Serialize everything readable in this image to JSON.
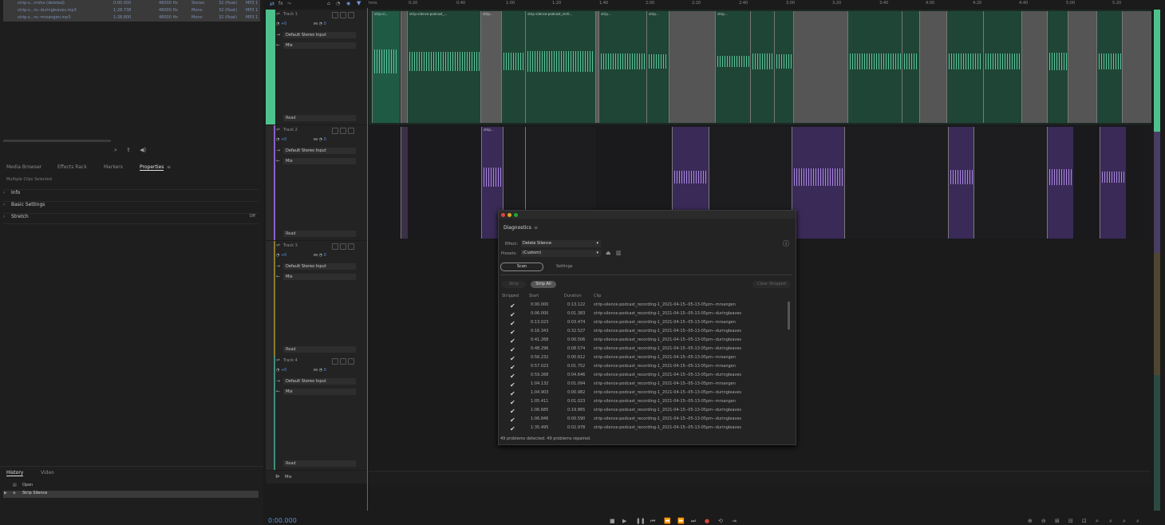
{
  "files": [
    {
      "name": "strip-s...nrdns (deleted)",
      "duration": "0:00.000",
      "rate": "48000 Hz",
      "channels": "Stereo",
      "bit": "32 (float)",
      "format": "MP3 1"
    },
    {
      "name": "strip-s...rs--duringleaves.mp3",
      "duration": "1:28.738",
      "rate": "48000 Hz",
      "channels": "Mono",
      "bit": "32 (float)",
      "format": "MP3 1"
    },
    {
      "name": "strip-s...rs--mrsangen.mp3",
      "duration": "1:28.800",
      "rate": "48000 Hz",
      "channels": "Mono",
      "bit": "32 (float)",
      "format": "MP3 1"
    }
  ],
  "panel_tabs": [
    "Media Browser",
    "Effects Rack",
    "Markers",
    "Properties"
  ],
  "panel_selection": "Multiple Clips Selected",
  "properties": [
    {
      "label": "Info",
      "value": ""
    },
    {
      "label": "Basic Settings",
      "value": ""
    },
    {
      "label": "Stretch",
      "value": "Off"
    }
  ],
  "history": {
    "tabs": [
      "History",
      "Video"
    ],
    "items": [
      "Open",
      "Strip Silence"
    ]
  },
  "timecode": "0:00.000",
  "ruler": [
    "hms",
    "0:20",
    "0:40",
    "1:00",
    "1:20",
    "1:40",
    "2:00",
    "2:20",
    "2:40",
    "3:00",
    "3:20",
    "3:40",
    "4:00",
    "4:20",
    "4:40",
    "5:00",
    "5:20"
  ],
  "tracks": [
    {
      "name": "Track 1",
      "vol": "+0",
      "pan": "0",
      "input": "Default Stereo Input",
      "mix": "Mix",
      "mode": "Read",
      "color": "#4ec28d"
    },
    {
      "name": "Track 2",
      "vol": "+0",
      "pan": "0",
      "input": "Default Stereo Input",
      "mix": "Mix",
      "mode": "Read",
      "color": "#8a5fc9"
    },
    {
      "name": "Track 3",
      "vol": "+0",
      "pan": "0",
      "input": "Default Stereo Input",
      "mix": "Mix",
      "mode": "Read",
      "color": "#8c7a2c"
    },
    {
      "name": "Track 4",
      "vol": "+0",
      "pan": "0",
      "input": "Default Stereo Input",
      "mix": "Mix",
      "mode": "Read",
      "color": "#3e8f7a"
    }
  ],
  "master": {
    "name": "Mix"
  },
  "clip_labels": {
    "t1": [
      "strip-si...",
      "strip-silence-podcast_...",
      "strip...",
      "strip-silence-podcast_recti...",
      "strip...",
      "strip...",
      "strip..."
    ],
    "t2": [
      "strip..."
    ]
  },
  "diagnostics": {
    "title": "Diagnostics",
    "effect_label": "Effect:",
    "effect_value": "Delete Silence",
    "presets_label": "Presets:",
    "presets_value": "(Custom)",
    "tabs": [
      "Scan",
      "Settings"
    ],
    "actions": [
      "Strip",
      "Strip All",
      "Clear Stripped"
    ],
    "columns": [
      "Stripped",
      "Start",
      "Duration",
      "Clip"
    ],
    "rows": [
      {
        "start": "0:00.000",
        "duration": "0:13.122",
        "clip": "strip-silence-podcast_recording-1_2021-04-15--05-13-05pm--mrsangen"
      },
      {
        "start": "0:06.000",
        "duration": "0:01.383",
        "clip": "strip-silence-podcast_recording-1_2021-04-15--05-13-05pm--duringleaves"
      },
      {
        "start": "0:13.023",
        "duration": "0:03.474",
        "clip": "strip-silence-podcast_recording-1_2021-04-15--05-13-05pm--mrsangen"
      },
      {
        "start": "0:16.343",
        "duration": "0:32.527",
        "clip": "strip-silence-podcast_recording-1_2021-04-15--05-13-05pm--duringleaves"
      },
      {
        "start": "0:41.268",
        "duration": "0:00.506",
        "clip": "strip-silence-podcast_recording-1_2021-04-15--05-13-05pm--duringleaves"
      },
      {
        "start": "0:48.296",
        "duration": "0:08.574",
        "clip": "strip-silence-podcast_recording-1_2021-04-15--05-13-05pm--duringleaves"
      },
      {
        "start": "0:56.232",
        "duration": "0:00.612",
        "clip": "strip-silence-podcast_recording-1_2021-04-15--05-13-05pm--mrsangen"
      },
      {
        "start": "0:57.023",
        "duration": "0:01.752",
        "clip": "strip-silence-podcast_recording-1_2021-04-15--05-13-05pm--mrsangen"
      },
      {
        "start": "0:59.268",
        "duration": "0:04.646",
        "clip": "strip-silence-podcast_recording-1_2021-04-15--05-13-05pm--duringleaves"
      },
      {
        "start": "1:04.132",
        "duration": "0:01.094",
        "clip": "strip-silence-podcast_recording-1_2021-04-15--05-13-05pm--mrsangen"
      },
      {
        "start": "1:04.903",
        "duration": "0:00.982",
        "clip": "strip-silence-podcast_recording-1_2021-04-15--05-13-05pm--duringleaves"
      },
      {
        "start": "1:05.411",
        "duration": "0:01.023",
        "clip": "strip-silence-podcast_recording-1_2021-04-15--05-13-05pm--mrsangen"
      },
      {
        "start": "1:06.685",
        "duration": "0:19.865",
        "clip": "strip-silence-podcast_recording-1_2021-04-15--05-13-05pm--duringleaves"
      },
      {
        "start": "1:06.846",
        "duration": "0:00.590",
        "clip": "strip-silence-podcast_recording-1_2021-04-15--05-13-05pm--duringleaves"
      },
      {
        "start": "1:35.495",
        "duration": "0:02.978",
        "clip": "strip-silence-podcast_recording-1_2021-04-15--05-13-05pm--duringleaves"
      }
    ],
    "status": "49 problems detected. 49 problems repaired."
  }
}
